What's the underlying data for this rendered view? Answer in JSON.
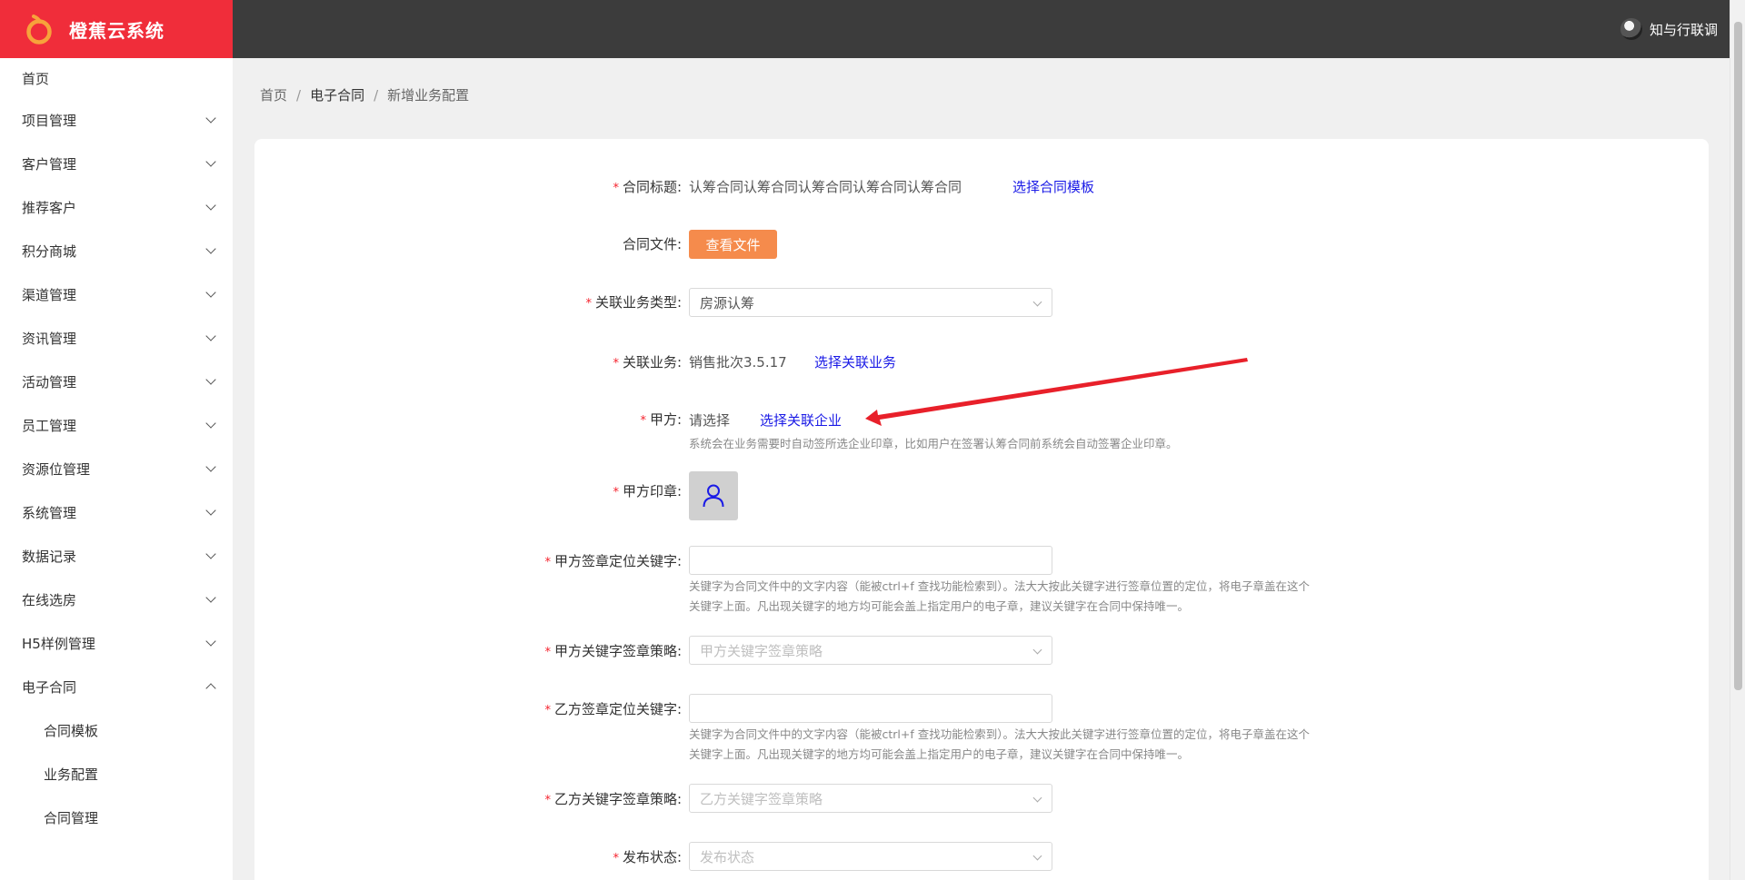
{
  "header": {
    "app_name": "橙蕉云系统",
    "user_name": "知与行联调",
    "brand_color": "#f02d3a"
  },
  "sidebar": {
    "items": [
      {
        "label": "首页",
        "expandable": false
      },
      {
        "label": "项目管理",
        "expandable": true
      },
      {
        "label": "客户管理",
        "expandable": true
      },
      {
        "label": "推荐客户",
        "expandable": true
      },
      {
        "label": "积分商城",
        "expandable": true
      },
      {
        "label": "渠道管理",
        "expandable": true
      },
      {
        "label": "资讯管理",
        "expandable": true
      },
      {
        "label": "活动管理",
        "expandable": true
      },
      {
        "label": "员工管理",
        "expandable": true
      },
      {
        "label": "资源位管理",
        "expandable": true
      },
      {
        "label": "系统管理",
        "expandable": true
      },
      {
        "label": "数据记录",
        "expandable": true
      },
      {
        "label": "在线选房",
        "expandable": true
      },
      {
        "label": "H5样例管理",
        "expandable": true
      },
      {
        "label": "电子合同",
        "expandable": true,
        "expanded": true
      }
    ],
    "sub_items": [
      "合同模板",
      "业务配置",
      "合同管理"
    ]
  },
  "breadcrumb": {
    "items": [
      "首页",
      "电子合同",
      "新增业务配置"
    ],
    "separator": "/"
  },
  "form": {
    "contract_title": {
      "label": "合同标题:",
      "value": "认筹合同认筹合同认筹合同认筹合同认筹合同",
      "action": "选择合同模板",
      "required": true
    },
    "contract_file": {
      "label": "合同文件:",
      "button": "查看文件",
      "required": false
    },
    "business_type": {
      "label": "关联业务类型:",
      "value": "房源认筹",
      "required": true
    },
    "business": {
      "label": "关联业务:",
      "value": "销售批次3.5.17",
      "action": "选择关联业务",
      "required": true
    },
    "party_a": {
      "label": "甲方:",
      "value": "请选择",
      "action": "选择关联企业",
      "hint": "系统会在业务需要时自动签所选企业印章，比如用户在签署认筹合同前系统会自动签署企业印章。",
      "required": true
    },
    "party_a_seal": {
      "label": "甲方印章:",
      "icon": "user-icon",
      "required": true
    },
    "party_a_keyword": {
      "label": "甲方签章定位关键字:",
      "value": "",
      "hint_line1": "关键字为合同文件中的文字内容（能被ctrl+f 查找功能检索到）。法大大按此关键字进行签章位置的定位，将电子章盖在这个",
      "hint_line2": "关键字上面。凡出现关键字的地方均可能会盖上指定用户的电子章，建议关键字在合同中保持唯一。",
      "required": true
    },
    "party_a_strategy": {
      "label": "甲方关键字签章策略:",
      "placeholder": "甲方关键字签章策略",
      "required": true
    },
    "party_b_keyword": {
      "label": "乙方签章定位关键字:",
      "value": "",
      "hint_line1": "关键字为合同文件中的文字内容（能被ctrl+f 查找功能检索到）。法大大按此关键字进行签章位置的定位，将电子章盖在这个",
      "hint_line2": "关键字上面。凡出现关键字的地方均可能会盖上指定用户的电子章，建议关键字在合同中保持唯一。",
      "required": true
    },
    "party_b_strategy": {
      "label": "乙方关键字签章策略:",
      "placeholder": "乙方关键字签章策略",
      "required": true
    },
    "publish_status": {
      "label": "发布状态:",
      "placeholder": "发布状态",
      "required": true
    },
    "required_mark": "*"
  },
  "colors": {
    "link": "#1a1ae6",
    "orange_button": "#f58b4c",
    "required": "#f5222d",
    "annotation_arrow": "#e8202a"
  }
}
